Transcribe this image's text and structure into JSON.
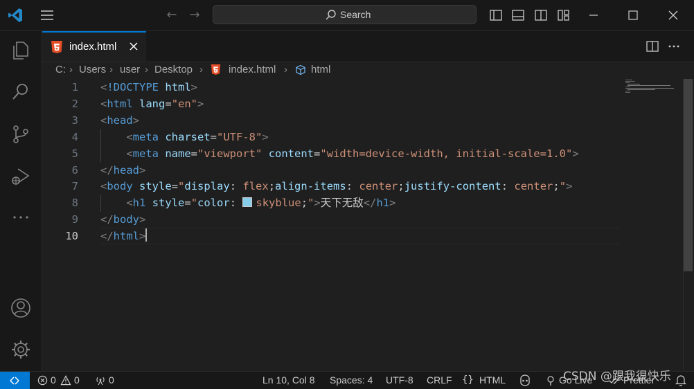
{
  "titlebar": {
    "search_label": "Search"
  },
  "tab": {
    "label": "index.html"
  },
  "breadcrumb": {
    "items": [
      "C:",
      "Users",
      "user",
      "Desktop",
      "index.html",
      "html"
    ]
  },
  "editor": {
    "line_numbers": [
      "1",
      "2",
      "3",
      "4",
      "5",
      "6",
      "7",
      "8",
      "9",
      "10"
    ],
    "active_line": "10",
    "lines": [
      [
        {
          "t": "punct",
          "v": "<"
        },
        {
          "t": "tag",
          "v": "!DOCTYPE"
        },
        {
          "t": "text",
          "v": " "
        },
        {
          "t": "attr",
          "v": "html"
        },
        {
          "t": "punct",
          "v": ">"
        }
      ],
      [
        {
          "t": "punct",
          "v": "<"
        },
        {
          "t": "tag",
          "v": "html"
        },
        {
          "t": "text",
          "v": " "
        },
        {
          "t": "attr",
          "v": "lang"
        },
        {
          "t": "text",
          "v": "="
        },
        {
          "t": "str",
          "v": "\"en\""
        },
        {
          "t": "punct",
          "v": ">"
        }
      ],
      [
        {
          "t": "punct",
          "v": "<"
        },
        {
          "t": "tag",
          "v": "head"
        },
        {
          "t": "punct",
          "v": ">"
        }
      ],
      [
        {
          "t": "text",
          "v": "    "
        },
        {
          "t": "punct",
          "v": "<"
        },
        {
          "t": "tag",
          "v": "meta"
        },
        {
          "t": "text",
          "v": " "
        },
        {
          "t": "attr",
          "v": "charset"
        },
        {
          "t": "text",
          "v": "="
        },
        {
          "t": "str",
          "v": "\"UTF-8\""
        },
        {
          "t": "punct",
          "v": ">"
        }
      ],
      [
        {
          "t": "text",
          "v": "    "
        },
        {
          "t": "punct",
          "v": "<"
        },
        {
          "t": "tag",
          "v": "meta"
        },
        {
          "t": "text",
          "v": " "
        },
        {
          "t": "attr",
          "v": "name"
        },
        {
          "t": "text",
          "v": "="
        },
        {
          "t": "str",
          "v": "\"viewport\""
        },
        {
          "t": "text",
          "v": " "
        },
        {
          "t": "attr",
          "v": "content"
        },
        {
          "t": "text",
          "v": "="
        },
        {
          "t": "str",
          "v": "\"width=device-width, initial-scale=1.0\""
        },
        {
          "t": "punct",
          "v": ">"
        }
      ],
      [
        {
          "t": "punct",
          "v": "</"
        },
        {
          "t": "tag",
          "v": "head"
        },
        {
          "t": "punct",
          "v": ">"
        }
      ],
      [
        {
          "t": "punct",
          "v": "<"
        },
        {
          "t": "tag",
          "v": "body"
        },
        {
          "t": "text",
          "v": " "
        },
        {
          "t": "attr",
          "v": "style"
        },
        {
          "t": "text",
          "v": "="
        },
        {
          "t": "str",
          "v": "\""
        },
        {
          "t": "attr",
          "v": "display"
        },
        {
          "t": "text",
          "v": ": "
        },
        {
          "t": "str",
          "v": "flex"
        },
        {
          "t": "text",
          "v": ";"
        },
        {
          "t": "attr",
          "v": "align-items"
        },
        {
          "t": "text",
          "v": ": "
        },
        {
          "t": "str",
          "v": "center"
        },
        {
          "t": "text",
          "v": ";"
        },
        {
          "t": "attr",
          "v": "justify-content"
        },
        {
          "t": "text",
          "v": ": "
        },
        {
          "t": "str",
          "v": "center"
        },
        {
          "t": "text",
          "v": ";"
        },
        {
          "t": "str",
          "v": "\""
        },
        {
          "t": "punct",
          "v": ">"
        }
      ],
      [
        {
          "t": "text",
          "v": "    "
        },
        {
          "t": "punct",
          "v": "<"
        },
        {
          "t": "tag",
          "v": "h1"
        },
        {
          "t": "text",
          "v": " "
        },
        {
          "t": "attr",
          "v": "style"
        },
        {
          "t": "text",
          "v": "="
        },
        {
          "t": "str",
          "v": "\""
        },
        {
          "t": "attr",
          "v": "color"
        },
        {
          "t": "text",
          "v": ": "
        },
        {
          "t": "swatch",
          "v": ""
        },
        {
          "t": "str",
          "v": "skyblue"
        },
        {
          "t": "text",
          "v": ";"
        },
        {
          "t": "str",
          "v": "\""
        },
        {
          "t": "punct",
          "v": ">"
        },
        {
          "t": "text",
          "v": "天下无敌"
        },
        {
          "t": "punct",
          "v": "</"
        },
        {
          "t": "tag",
          "v": "h1"
        },
        {
          "t": "punct",
          "v": ">"
        }
      ],
      [
        {
          "t": "punct",
          "v": "</"
        },
        {
          "t": "tag",
          "v": "body"
        },
        {
          "t": "punct",
          "v": ">"
        }
      ],
      [
        {
          "t": "punct",
          "v": "</"
        },
        {
          "t": "tag",
          "v": "html"
        },
        {
          "t": "punct",
          "v": ">"
        },
        {
          "t": "caret",
          "v": ""
        }
      ]
    ]
  },
  "statusbar": {
    "errors": "0",
    "warnings": "0",
    "ports": "0",
    "position": "Ln 10, Col 8",
    "spaces": "Spaces: 4",
    "encoding": "UTF-8",
    "eol": "CRLF",
    "language": "HTML",
    "go_live": "Go Live",
    "prettier": "Prettier"
  },
  "watermark": "CSDN @跟我很快乐",
  "colors": {
    "accent": "#0078d4",
    "tag": "#569cd6",
    "attr": "#9cdcfe",
    "string": "#ce9178",
    "html_icon": "#e44d26",
    "swatch": "#87ceeb"
  },
  "icons": [
    "vscode-logo-icon",
    "menu-icon",
    "back-arrow-icon",
    "forward-arrow-icon",
    "search-icon",
    "toggle-primary-sidebar-icon",
    "toggle-panel-icon",
    "toggle-secondary-sidebar-icon",
    "customize-layout-icon",
    "minimize-icon",
    "maximize-icon",
    "close-window-icon",
    "explorer-icon",
    "search-view-icon",
    "source-control-icon",
    "run-debug-icon",
    "more-icon",
    "accounts-icon",
    "settings-gear-icon",
    "html-file-icon",
    "close-tab-icon",
    "split-editor-icon",
    "more-actions-icon",
    "symbol-element-icon",
    "remote-icon",
    "error-icon",
    "warning-icon",
    "ports-icon",
    "braces-icon",
    "copilot-icon",
    "broadcast-icon",
    "double-check-icon",
    "bell-icon"
  ]
}
